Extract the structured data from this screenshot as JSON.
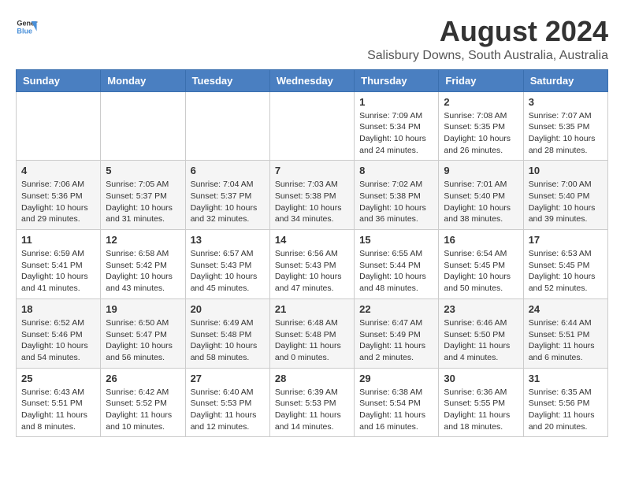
{
  "header": {
    "logo_general": "General",
    "logo_blue": "Blue",
    "title": "August 2024",
    "subtitle": "Salisbury Downs, South Australia, Australia"
  },
  "calendar": {
    "weekdays": [
      "Sunday",
      "Monday",
      "Tuesday",
      "Wednesday",
      "Thursday",
      "Friday",
      "Saturday"
    ],
    "weeks": [
      [
        {
          "day": "",
          "info": ""
        },
        {
          "day": "",
          "info": ""
        },
        {
          "day": "",
          "info": ""
        },
        {
          "day": "",
          "info": ""
        },
        {
          "day": "1",
          "info": "Sunrise: 7:09 AM\nSunset: 5:34 PM\nDaylight: 10 hours\nand 24 minutes."
        },
        {
          "day": "2",
          "info": "Sunrise: 7:08 AM\nSunset: 5:35 PM\nDaylight: 10 hours\nand 26 minutes."
        },
        {
          "day": "3",
          "info": "Sunrise: 7:07 AM\nSunset: 5:35 PM\nDaylight: 10 hours\nand 28 minutes."
        }
      ],
      [
        {
          "day": "4",
          "info": "Sunrise: 7:06 AM\nSunset: 5:36 PM\nDaylight: 10 hours\nand 29 minutes."
        },
        {
          "day": "5",
          "info": "Sunrise: 7:05 AM\nSunset: 5:37 PM\nDaylight: 10 hours\nand 31 minutes."
        },
        {
          "day": "6",
          "info": "Sunrise: 7:04 AM\nSunset: 5:37 PM\nDaylight: 10 hours\nand 32 minutes."
        },
        {
          "day": "7",
          "info": "Sunrise: 7:03 AM\nSunset: 5:38 PM\nDaylight: 10 hours\nand 34 minutes."
        },
        {
          "day": "8",
          "info": "Sunrise: 7:02 AM\nSunset: 5:38 PM\nDaylight: 10 hours\nand 36 minutes."
        },
        {
          "day": "9",
          "info": "Sunrise: 7:01 AM\nSunset: 5:40 PM\nDaylight: 10 hours\nand 38 minutes."
        },
        {
          "day": "10",
          "info": "Sunrise: 7:00 AM\nSunset: 5:40 PM\nDaylight: 10 hours\nand 39 minutes."
        }
      ],
      [
        {
          "day": "11",
          "info": "Sunrise: 6:59 AM\nSunset: 5:41 PM\nDaylight: 10 hours\nand 41 minutes."
        },
        {
          "day": "12",
          "info": "Sunrise: 6:58 AM\nSunset: 5:42 PM\nDaylight: 10 hours\nand 43 minutes."
        },
        {
          "day": "13",
          "info": "Sunrise: 6:57 AM\nSunset: 5:43 PM\nDaylight: 10 hours\nand 45 minutes."
        },
        {
          "day": "14",
          "info": "Sunrise: 6:56 AM\nSunset: 5:43 PM\nDaylight: 10 hours\nand 47 minutes."
        },
        {
          "day": "15",
          "info": "Sunrise: 6:55 AM\nSunset: 5:44 PM\nDaylight: 10 hours\nand 48 minutes."
        },
        {
          "day": "16",
          "info": "Sunrise: 6:54 AM\nSunset: 5:45 PM\nDaylight: 10 hours\nand 50 minutes."
        },
        {
          "day": "17",
          "info": "Sunrise: 6:53 AM\nSunset: 5:45 PM\nDaylight: 10 hours\nand 52 minutes."
        }
      ],
      [
        {
          "day": "18",
          "info": "Sunrise: 6:52 AM\nSunset: 5:46 PM\nDaylight: 10 hours\nand 54 minutes."
        },
        {
          "day": "19",
          "info": "Sunrise: 6:50 AM\nSunset: 5:47 PM\nDaylight: 10 hours\nand 56 minutes."
        },
        {
          "day": "20",
          "info": "Sunrise: 6:49 AM\nSunset: 5:48 PM\nDaylight: 10 hours\nand 58 minutes."
        },
        {
          "day": "21",
          "info": "Sunrise: 6:48 AM\nSunset: 5:48 PM\nDaylight: 11 hours\nand 0 minutes."
        },
        {
          "day": "22",
          "info": "Sunrise: 6:47 AM\nSunset: 5:49 PM\nDaylight: 11 hours\nand 2 minutes."
        },
        {
          "day": "23",
          "info": "Sunrise: 6:46 AM\nSunset: 5:50 PM\nDaylight: 11 hours\nand 4 minutes."
        },
        {
          "day": "24",
          "info": "Sunrise: 6:44 AM\nSunset: 5:51 PM\nDaylight: 11 hours\nand 6 minutes."
        }
      ],
      [
        {
          "day": "25",
          "info": "Sunrise: 6:43 AM\nSunset: 5:51 PM\nDaylight: 11 hours\nand 8 minutes."
        },
        {
          "day": "26",
          "info": "Sunrise: 6:42 AM\nSunset: 5:52 PM\nDaylight: 11 hours\nand 10 minutes."
        },
        {
          "day": "27",
          "info": "Sunrise: 6:40 AM\nSunset: 5:53 PM\nDaylight: 11 hours\nand 12 minutes."
        },
        {
          "day": "28",
          "info": "Sunrise: 6:39 AM\nSunset: 5:53 PM\nDaylight: 11 hours\nand 14 minutes."
        },
        {
          "day": "29",
          "info": "Sunrise: 6:38 AM\nSunset: 5:54 PM\nDaylight: 11 hours\nand 16 minutes."
        },
        {
          "day": "30",
          "info": "Sunrise: 6:36 AM\nSunset: 5:55 PM\nDaylight: 11 hours\nand 18 minutes."
        },
        {
          "day": "31",
          "info": "Sunrise: 6:35 AM\nSunset: 5:56 PM\nDaylight: 11 hours\nand 20 minutes."
        }
      ]
    ]
  }
}
